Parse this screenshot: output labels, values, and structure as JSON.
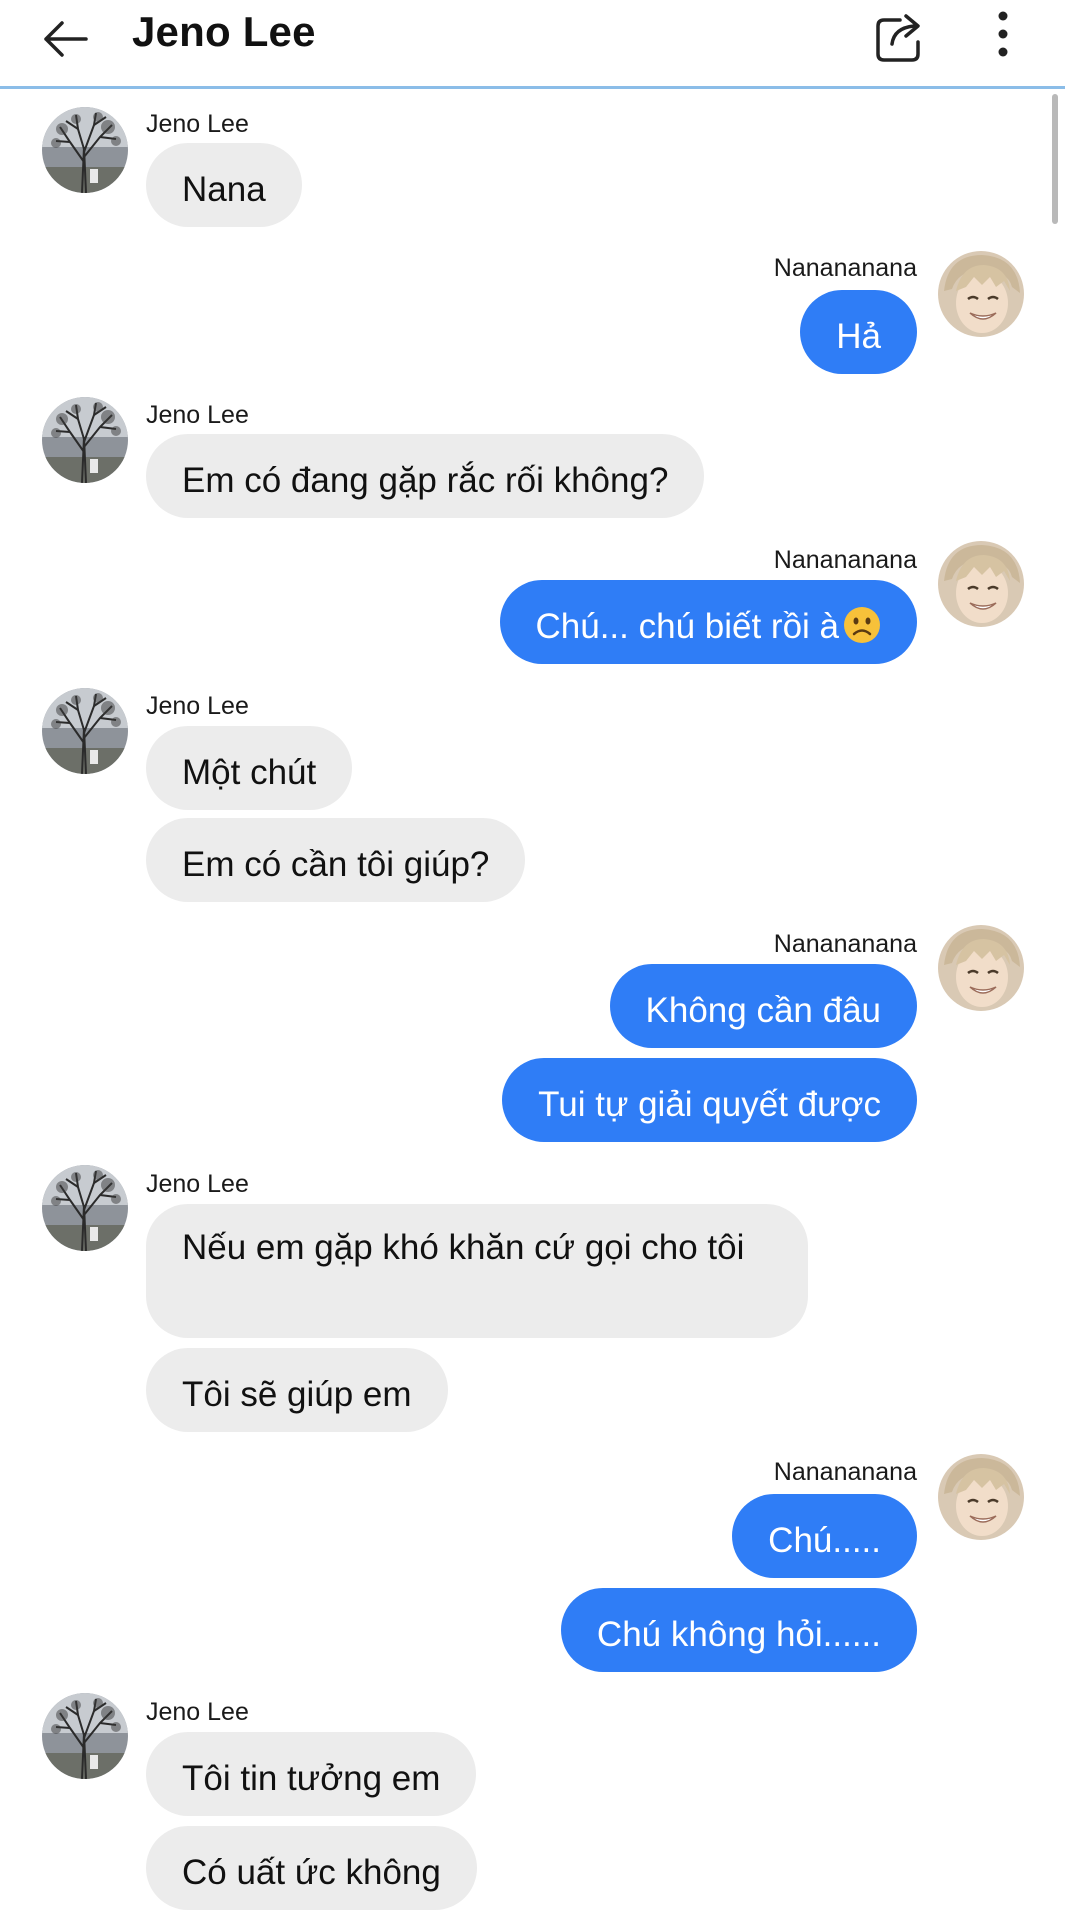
{
  "header": {
    "title": "Jeno Lee"
  },
  "colors": {
    "outgoing_bubble": "#2f7df6",
    "incoming_bubble": "#ececec",
    "header_divider": "#8bbde8"
  },
  "icons": {
    "back": "back-arrow-icon",
    "share": "share-icon",
    "more": "more-vertical-icon"
  },
  "messages": [
    {
      "sender": "Jeno Lee",
      "direction": "incoming",
      "text": "Nana"
    },
    {
      "sender": "Nanananana",
      "direction": "outgoing",
      "text": "Hả"
    },
    {
      "sender": "Jeno Lee",
      "direction": "incoming",
      "text": "Em có đang gặp rắc rối không?"
    },
    {
      "sender": "Nanananana",
      "direction": "outgoing",
      "text": "Chú... chú biết rồi à",
      "emoji": "slightly-frowning-face"
    },
    {
      "sender": "Jeno Lee",
      "direction": "incoming",
      "text": "Một chút"
    },
    {
      "sender": "Jeno Lee",
      "direction": "incoming",
      "text": "Em có cần tôi giúp?"
    },
    {
      "sender": "Nanananana",
      "direction": "outgoing",
      "text": "Không cần đâu"
    },
    {
      "sender": "Nanananana",
      "direction": "outgoing",
      "text": "Tui tự giải quyết được"
    },
    {
      "sender": "Jeno Lee",
      "direction": "incoming",
      "text": "Nếu em gặp khó khăn cứ gọi cho tôi"
    },
    {
      "sender": "Jeno Lee",
      "direction": "incoming",
      "text": "Tôi sẽ giúp em"
    },
    {
      "sender": "Nanananana",
      "direction": "outgoing",
      "text": "Chú....."
    },
    {
      "sender": "Nanananana",
      "direction": "outgoing",
      "text": "Chú không hỏi......"
    },
    {
      "sender": "Jeno Lee",
      "direction": "incoming",
      "text": "Tôi tin tưởng em"
    },
    {
      "sender": "Jeno Lee",
      "direction": "incoming",
      "text": "Có uất ức không"
    }
  ]
}
